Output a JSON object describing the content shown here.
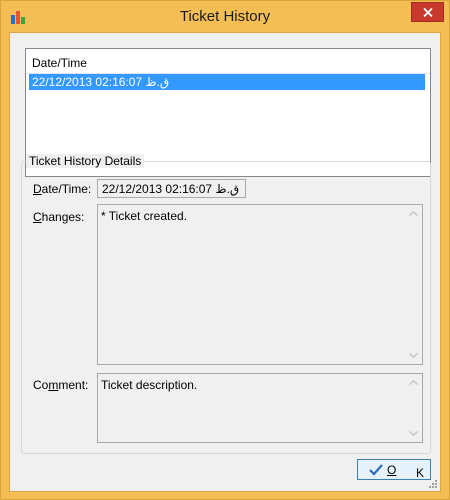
{
  "window": {
    "title": "Ticket History",
    "accent": "#f5be54",
    "close_color": "#c7392c"
  },
  "history_list": {
    "column_header": "Date/Time",
    "rows": [
      "22/12/2013 02:16:07 ق.ظ"
    ]
  },
  "details": {
    "group_title": "Ticket History Details",
    "date_label_hotkey": "D",
    "date_label_rest": "ate/Time:",
    "date_value": "22/12/2013 02:16:07 ق.ظ",
    "changes_label_hotkey": "C",
    "changes_label_rest": "hanges:",
    "changes_value": "* Ticket created.",
    "comment_label_pre": "Co",
    "comment_label_hotkey": "m",
    "comment_label_rest": "ment:",
    "comment_value": "Ticket description."
  },
  "buttons": {
    "ok_hotkey": "O",
    "ok_rest": "K"
  },
  "icons": {
    "app": "bar-chart-icon",
    "close": "close-icon",
    "ok": "checkmark-icon",
    "scroll_up": "chevron-up-icon",
    "scroll_down": "chevron-down-icon",
    "resize": "resize-grip-icon"
  }
}
